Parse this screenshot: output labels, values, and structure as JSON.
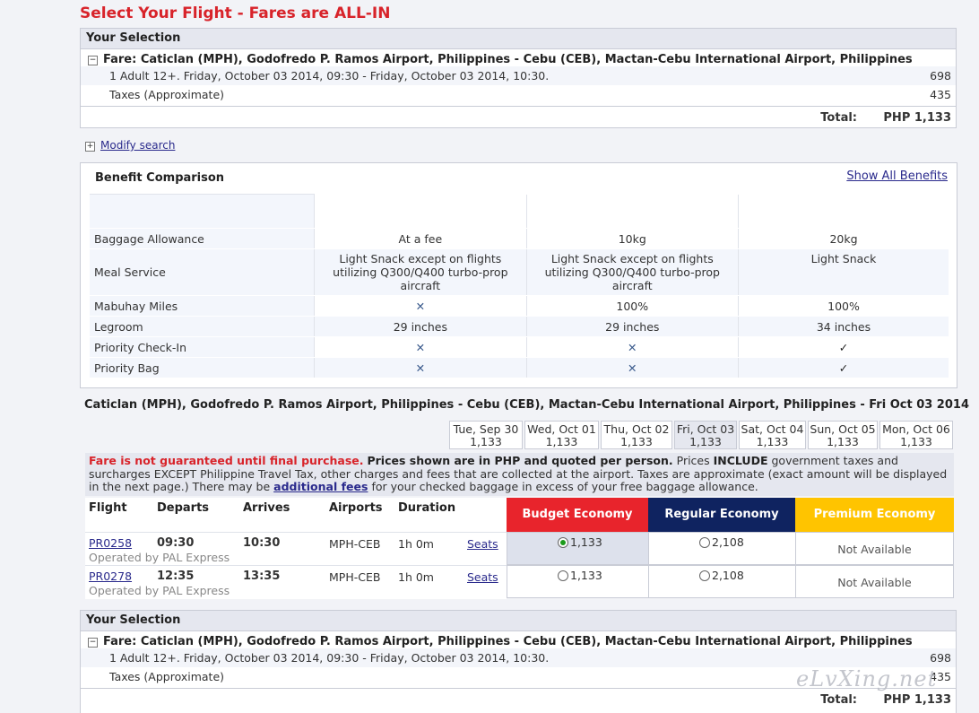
{
  "page_title": "Select Your Flight - Fares are ALL-IN",
  "selection_top": {
    "header": "Your Selection",
    "fare": "Fare: Caticlan (MPH), Godofredo P. Ramos Airport, Philippines - Cebu (CEB), Mactan-Cebu International Airport, Philippines",
    "detail": "1 Adult 12+. Friday, October 03 2014, 09:30 - Friday, October 03 2014, 10:30.",
    "detail_amount": "698",
    "taxes_label": "Taxes (Approximate)",
    "taxes_amount": "435",
    "total_label": "Total:",
    "total_amount": "PHP 1,133"
  },
  "modify_search": "Modify search",
  "benefits": {
    "title": "Benefit Comparison",
    "show_all": "Show All Benefits",
    "columns": [
      "Budget Economy",
      "Regular Economy",
      "Premium Economy"
    ],
    "rows": [
      {
        "label": "Baggage Allowance",
        "values": [
          "At a fee",
          "10kg",
          "20kg"
        ]
      },
      {
        "label": "Meal Service",
        "values": [
          "Light Snack except on flights utilizing Q300/Q400 turbo-prop aircraft",
          "Light Snack except on flights utilizing Q300/Q400 turbo-prop aircraft",
          "Light Snack"
        ]
      },
      {
        "label": "Mabuhay Miles",
        "values": [
          "✕",
          "100%",
          "100%"
        ]
      },
      {
        "label": "Legroom",
        "values": [
          "29 inches",
          "29 inches",
          "34 inches"
        ]
      },
      {
        "label": "Priority Check-In",
        "values": [
          "✕",
          "✕",
          "✓"
        ]
      },
      {
        "label": "Priority Bag",
        "values": [
          "✕",
          "✕",
          "✓"
        ]
      }
    ]
  },
  "route_title": "Caticlan (MPH), Godofredo P. Ramos Airport, Philippines - Cebu (CEB), Mactan-Cebu International Airport, Philippines - Fri Oct 03 2014",
  "days": [
    {
      "date": "Tue, Sep 30",
      "price": "1,133",
      "selected": false
    },
    {
      "date": "Wed, Oct 01",
      "price": "1,133",
      "selected": false
    },
    {
      "date": "Thu, Oct 02",
      "price": "1,133",
      "selected": false
    },
    {
      "date": "Fri, Oct 03",
      "price": "1,133",
      "selected": true
    },
    {
      "date": "Sat, Oct 04",
      "price": "1,133",
      "selected": false
    },
    {
      "date": "Sun, Oct 05",
      "price": "1,133",
      "selected": false
    },
    {
      "date": "Mon, Oct 06",
      "price": "1,133",
      "selected": false
    }
  ],
  "notice": {
    "red": "Fare is not guaranteed until final purchase.",
    "bold1": "Prices shown are in PHP and quoted per person.",
    "text1": "Prices",
    "bold2": "INCLUDE",
    "text2": "government taxes and surcharges EXCEPT Philippine Travel Tax, other charges and fees that are collected at the airport. Taxes are approximate (exact amount will be displayed in the next page.) There may be",
    "link": "additional fees",
    "text3": "for your checked baggage in excess of your free baggage allowance."
  },
  "flight_headers": {
    "flight": "Flight",
    "departs": "Departs",
    "arrives": "Arrives",
    "airports": "Airports",
    "duration": "Duration"
  },
  "flights": [
    {
      "number": "PR0258",
      "operator": "Operated by PAL Express",
      "departs": "09:30",
      "arrives": "10:30",
      "airports": "MPH-CEB",
      "duration": "1h 0m",
      "seats": "Seats",
      "budget": "1,133",
      "regular": "2,108",
      "premium": "Not Available",
      "selected": true
    },
    {
      "number": "PR0278",
      "operator": "Operated by PAL Express",
      "departs": "12:35",
      "arrives": "13:35",
      "airports": "MPH-CEB",
      "duration": "1h 0m",
      "seats": "Seats",
      "budget": "1,133",
      "regular": "2,108",
      "premium": "Not Available",
      "selected": false
    }
  ],
  "selection_bottom": {
    "header": "Your Selection",
    "fare": "Fare: Caticlan (MPH), Godofredo P. Ramos Airport, Philippines - Cebu (CEB), Mactan-Cebu International Airport, Philippines",
    "detail": "1 Adult 12+. Friday, October 03 2014, 09:30 - Friday, October 03 2014, 10:30.",
    "detail_amount": "698",
    "taxes_label": "Taxes (Approximate)",
    "taxes_amount": "435",
    "total_label": "Total:",
    "total_amount": "PHP 1,133"
  },
  "watermark": "eLvXing.net",
  "colors": {
    "budget": "#e8242c",
    "regular": "#0f2360",
    "premium": "#ffc400",
    "title_red": "#d8232a"
  }
}
